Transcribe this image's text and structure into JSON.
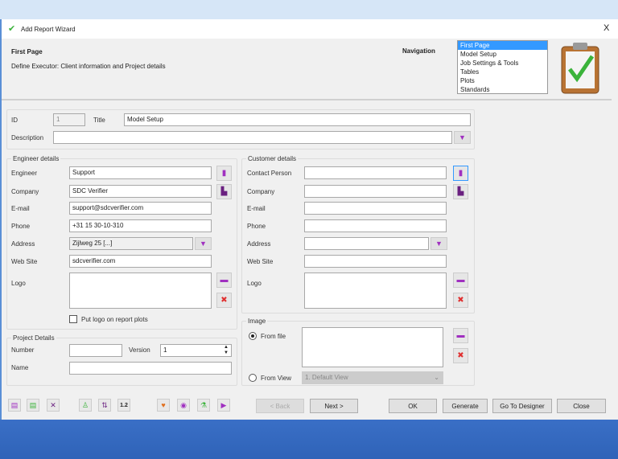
{
  "window": {
    "title": "Add Report Wizard",
    "close": "X"
  },
  "header": {
    "title": "First Page",
    "subtitle": "Define Executor: Client information and Project details",
    "navigation_label": "Navigation",
    "navigation_items": [
      "First Page",
      "Model Setup",
      "Job Settings & Tools",
      "Tables",
      "Plots",
      "Standards"
    ],
    "selected_index": 0
  },
  "general": {
    "id_label": "ID",
    "id_value": "1",
    "title_label": "Title",
    "title_value": "Model Setup",
    "description_label": "Description",
    "description_value": ""
  },
  "engineer": {
    "group_label": "Engineer details",
    "engineer_label": "Engineer",
    "engineer_value": "Support",
    "company_label": "Company",
    "company_value": "SDC Verifier",
    "email_label": "E-mail",
    "email_value": "support@sdcverifier.com",
    "phone_label": "Phone",
    "phone_value": "+31 15 30-10-310",
    "address_label": "Address",
    "address_value": "Zijlweg 25 [...]",
    "website_label": "Web Site",
    "website_value": "sdcverifier.com",
    "logo_label": "Logo",
    "put_logo_label": "Put logo on report plots",
    "put_logo_checked": false
  },
  "project": {
    "group_label": "Project Details",
    "number_label": "Number",
    "number_value": "",
    "version_label": "Version",
    "version_value": "1",
    "name_label": "Name",
    "name_value": ""
  },
  "customer": {
    "group_label": "Customer details",
    "contact_label": "Contact Person",
    "contact_value": "",
    "company_label": "Company",
    "company_value": "",
    "email_label": "E-mail",
    "email_value": "",
    "phone_label": "Phone",
    "phone_value": "",
    "address_label": "Address",
    "address_value": "",
    "website_label": "Web Site",
    "website_value": "",
    "logo_label": "Logo"
  },
  "image": {
    "group_label": "Image",
    "from_file_label": "From file",
    "from_view_label": "From View",
    "from_view_value": "1. Default View",
    "selected": "From file"
  },
  "footer": {
    "back": "< Back",
    "next": "Next >",
    "ok": "OK",
    "generate": "Generate",
    "go_to_designer": "Go To Designer",
    "close": "Close"
  },
  "colors": {
    "accent_purple": "#a030c0",
    "delete_red": "#e03030",
    "selection_blue": "#3399ff",
    "taskbar": "#3f74c8"
  }
}
